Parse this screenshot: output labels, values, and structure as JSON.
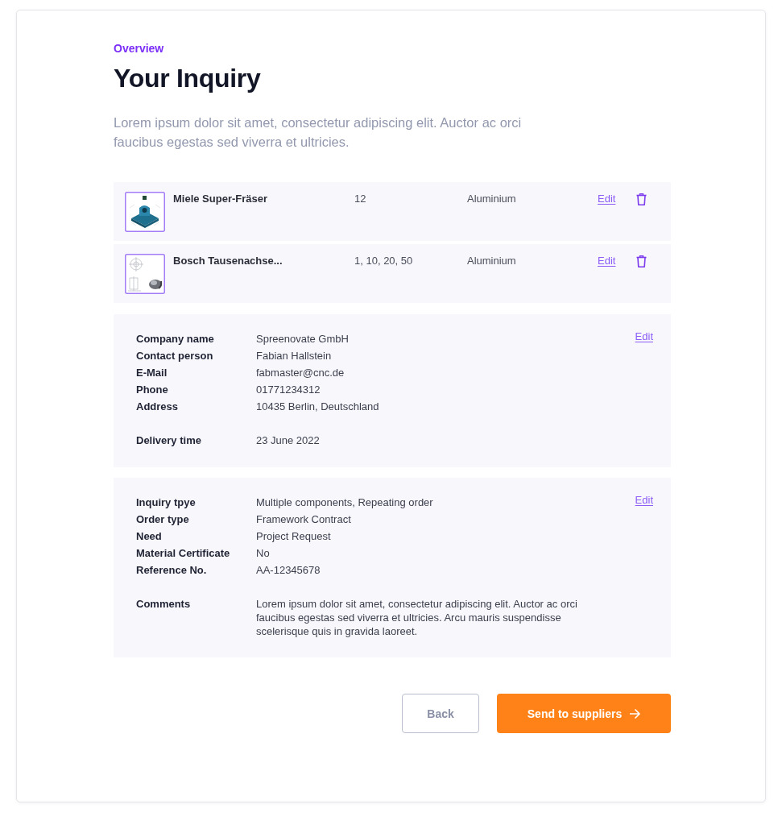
{
  "header": {
    "eyebrow": "Overview",
    "title": "Your Inquiry",
    "intro": "Lorem ipsum dolor sit amet, consectetur adipiscing elit. Auctor ac orci faucibus egestas sed viverra et ultricies."
  },
  "products": [
    {
      "kind": "render",
      "name": "Miele Super-Fräser",
      "quantity": "12",
      "material": "Aluminium",
      "edit": "Edit"
    },
    {
      "kind": "sketch",
      "name": "Bosch Tausenachse...",
      "quantity": "1, 10, 20, 50",
      "material": "Aluminium",
      "edit": "Edit"
    }
  ],
  "sections": [
    {
      "edit": "Edit",
      "groups": [
        {
          "fields": [
            {
              "label": "Company name",
              "value": "Spreenovate GmbH"
            },
            {
              "label": "Contact person",
              "value": "Fabian Hallstein"
            },
            {
              "label": "E-Mail",
              "value": "fabmaster@cnc.de"
            },
            {
              "label": "Phone",
              "value": "01771234312"
            },
            {
              "label": "Address",
              "value": "10435 Berlin, Deutschland"
            }
          ]
        },
        {
          "fields": [
            {
              "label": "Delivery time",
              "value": "23 June 2022"
            }
          ]
        }
      ]
    },
    {
      "edit": "Edit",
      "groups": [
        {
          "fields": [
            {
              "label": "Inquiry tpye",
              "value": "Multiple components, Repeating order"
            },
            {
              "label": "Order type",
              "value": "Framework Contract"
            },
            {
              "label": "Need",
              "value": "Project Request"
            },
            {
              "label": "Material Certificate",
              "value": "No"
            },
            {
              "label": "Reference No.",
              "value": "AA-12345678"
            }
          ]
        },
        {
          "fields": [
            {
              "label": "Comments",
              "value": "Lorem ipsum dolor sit amet, consectetur adipiscing elit. Auctor ac orci faucibus egestas sed viverra et ultricies. Arcu mauris suspendisse scelerisque quis in gravida laoreet."
            }
          ]
        }
      ]
    }
  ],
  "actions": [
    {
      "kind": "secondary",
      "label": "Back"
    },
    {
      "kind": "primary",
      "label": "Send to suppliers"
    }
  ]
}
